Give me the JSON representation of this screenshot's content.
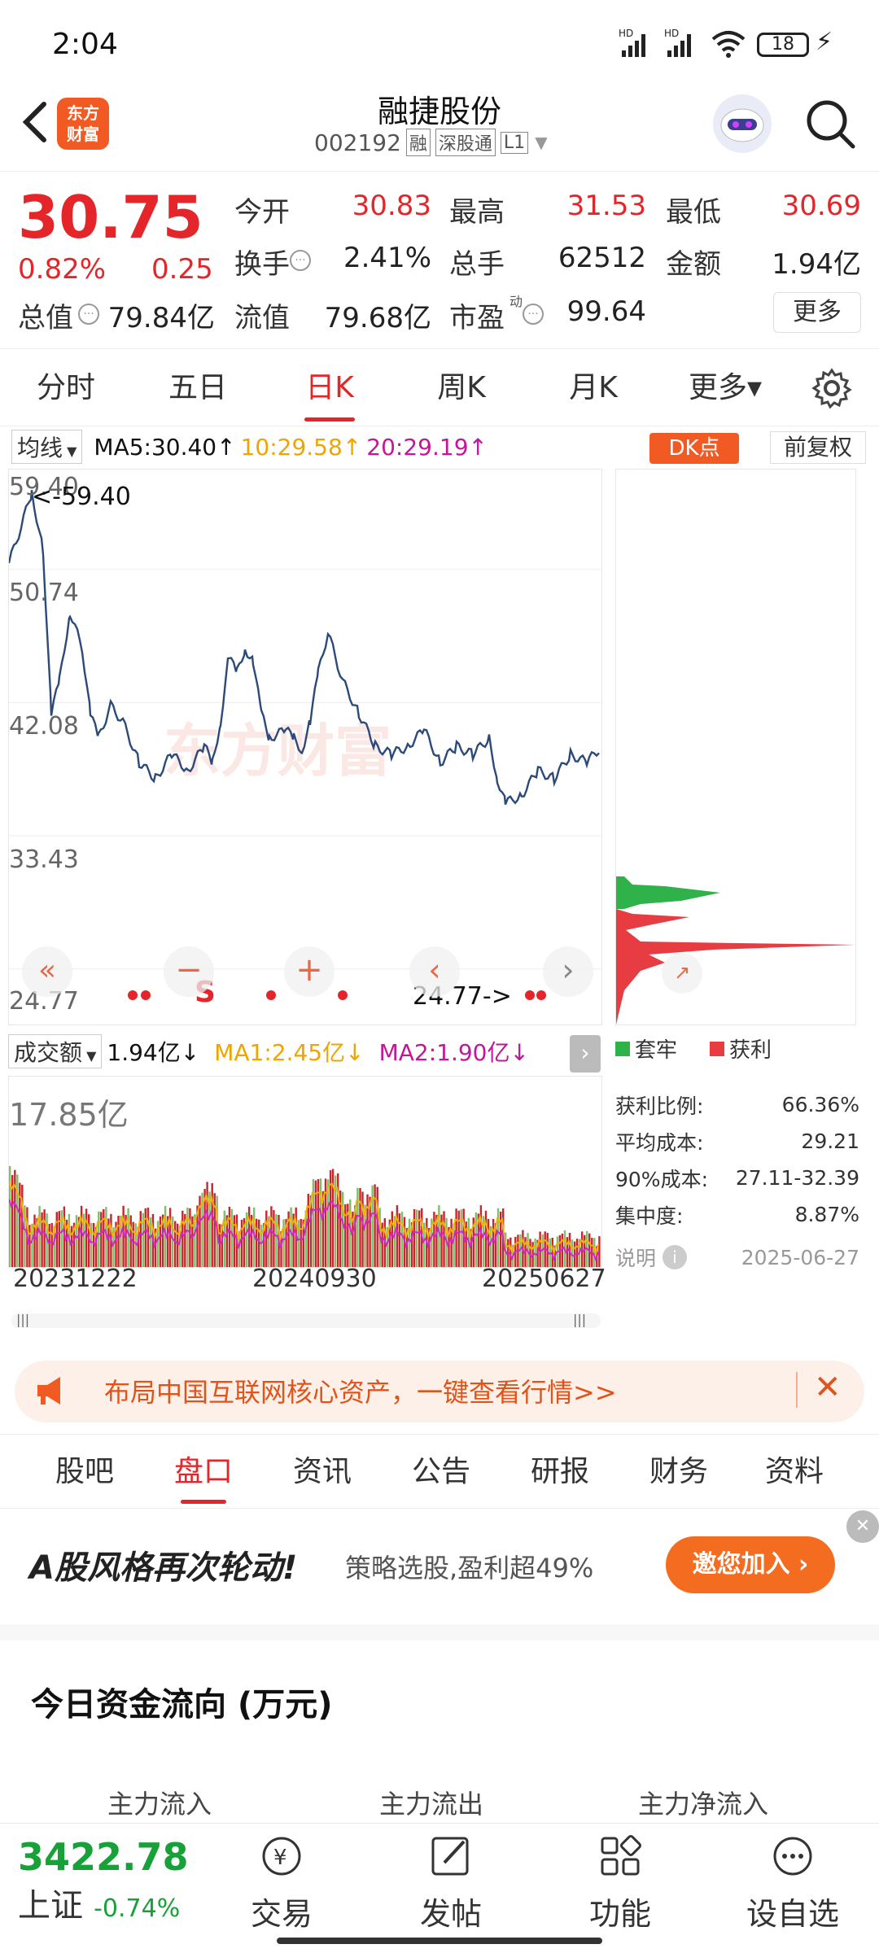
{
  "status_bar": {
    "time": "2:04",
    "signal1": "HD",
    "signal2": "HD",
    "battery": "18"
  },
  "header": {
    "title": "融捷股份",
    "code": "002192",
    "tag1": "融",
    "tag2": "深股通",
    "tag3": "L1",
    "logo_text": "东方\n财富"
  },
  "quote": {
    "price": "30.75",
    "change_pct": "0.82%",
    "change": "0.25",
    "open_label": "今开",
    "open": "30.83",
    "high_label": "最高",
    "high": "31.53",
    "low_label": "最低",
    "low": "30.69",
    "turnover_label": "换手",
    "turnover": "2.41%",
    "volume_label": "总手",
    "volume": "62512",
    "amount_label": "金额",
    "amount": "1.94亿",
    "mktcap_label": "总值",
    "mktcap": "79.84亿",
    "float_label": "流值",
    "float": "79.68亿",
    "pe_label": "市盈",
    "pe_sup": "动",
    "pe": "99.64",
    "more": "更多"
  },
  "period_tabs": [
    {
      "label": "分时"
    },
    {
      "label": "五日"
    },
    {
      "label": "日K"
    },
    {
      "label": "周K"
    },
    {
      "label": "月K"
    },
    {
      "label": "更多▾"
    }
  ],
  "ma_bar": {
    "selector": "均线",
    "ma5": "MA5:30.40↑",
    "ma10": "10:29.58↑",
    "ma20": "20:29.19↑",
    "dk": "DK点",
    "adjust": "前复权"
  },
  "price_chart": {
    "ticks": [
      "59.40",
      "50.74",
      "42.08",
      "33.43",
      "24.77"
    ],
    "max_note": "<-59.40",
    "min_note": "24.77->",
    "watermark": "东方财富",
    "signal": "S",
    "colors": {
      "line": "#2b4a7a",
      "grid": "#eeeeee"
    }
  },
  "volume_bar": {
    "selector": "成交额",
    "value": "1.94亿↓",
    "ma1": "MA1:2.45亿↓",
    "ma2": "MA2:1.90亿↓",
    "max_label": "17.85亿",
    "dates": [
      "20231222",
      "20240930",
      "20250627"
    ]
  },
  "chip_panel": {
    "legend_trap": "套牢",
    "legend_profit": "获利",
    "rows": [
      {
        "label": "获利比例:",
        "value": "66.36%"
      },
      {
        "label": "平均成本:",
        "value": "29.21"
      },
      {
        "label": "90%成本:",
        "value": "27.11-32.39"
      },
      {
        "label": "集中度:",
        "value": "8.87%"
      }
    ],
    "note_label": "说明",
    "date": "2025-06-27"
  },
  "promo": {
    "text": "布局中国互联网核心资产，一键查看行情>>"
  },
  "section_tabs": [
    {
      "label": "股吧"
    },
    {
      "label": "盘口"
    },
    {
      "label": "资讯"
    },
    {
      "label": "公告"
    },
    {
      "label": "研报"
    },
    {
      "label": "财务"
    },
    {
      "label": "资料"
    }
  ],
  "ad": {
    "headline": "A股风格再次轮动!",
    "sub": "策略选股,盈利超49%",
    "cta": "邀您加入 ›"
  },
  "fund_flow": {
    "title": "今日资金流向 (万元)",
    "cols": [
      "主力流入",
      "主力流出",
      "主力净流入"
    ]
  },
  "bottom_nav": {
    "index_value": "3422.78",
    "index_name": "上证",
    "index_change": "-0.74%",
    "items": [
      {
        "label": "交易"
      },
      {
        "label": "发帖"
      },
      {
        "label": "功能"
      },
      {
        "label": "设自选"
      }
    ]
  }
}
